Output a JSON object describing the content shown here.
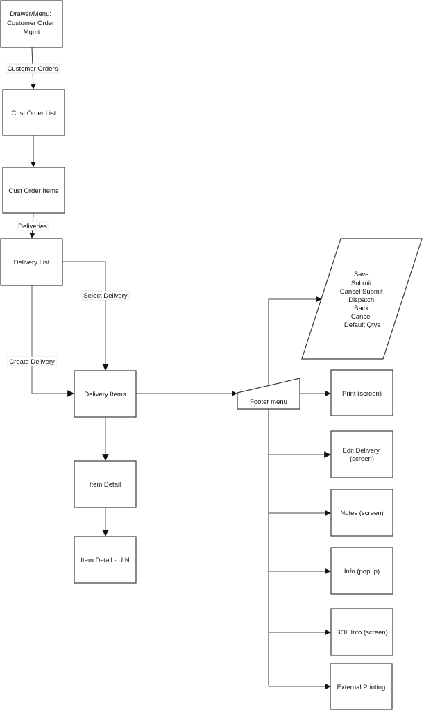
{
  "diagram": {
    "type": "flowchart",
    "nodes": {
      "drawer_menu": {
        "lines": [
          "Drawer/Menu:",
          "Customer Order",
          "Mgmt"
        ]
      },
      "cust_order_list": {
        "lines": [
          "Cust Order List"
        ]
      },
      "cust_order_items": {
        "lines": [
          "Cust Order Items"
        ]
      },
      "delivery_list": {
        "lines": [
          "Delivery List"
        ]
      },
      "delivery_items": {
        "lines": [
          "Delivery Items"
        ]
      },
      "item_detail": {
        "lines": [
          "Item Detail"
        ]
      },
      "item_detail_uin": {
        "lines": [
          "Item Detail - UIN"
        ]
      },
      "footer_menu": {
        "lines": [
          "Footer menu"
        ]
      },
      "footer_actions": {
        "lines": [
          "Save",
          "Submit",
          "Cancel Submit",
          "Dispatch",
          "Back",
          "Cancel",
          "Default Qtys"
        ]
      },
      "print_screen": {
        "lines": [
          "Print (screen)"
        ]
      },
      "edit_delivery": {
        "lines": [
          "Edit Delivery",
          "(screen)"
        ]
      },
      "notes_screen": {
        "lines": [
          "Notes (screen)"
        ]
      },
      "info_popup": {
        "lines": [
          "Info (popup)"
        ]
      },
      "bol_info": {
        "lines": [
          "BOL Info (screen)"
        ]
      },
      "external_printing": {
        "lines": [
          "External Printing"
        ]
      }
    },
    "edges": [
      {
        "from": "drawer_menu",
        "to": "cust_order_list",
        "label": "Customer Orders"
      },
      {
        "from": "cust_order_list",
        "to": "cust_order_items",
        "label": ""
      },
      {
        "from": "cust_order_items",
        "to": "delivery_list",
        "label": "Deliveries"
      },
      {
        "from": "delivery_list",
        "to": "delivery_items",
        "label": "Select Delivery"
      },
      {
        "from": "delivery_list",
        "to": "delivery_items",
        "label": "Create Delivery"
      },
      {
        "from": "delivery_items",
        "to": "footer_menu",
        "label": ""
      },
      {
        "from": "delivery_items",
        "to": "item_detail",
        "label": ""
      },
      {
        "from": "item_detail",
        "to": "item_detail_uin",
        "label": ""
      },
      {
        "from": "footer_menu",
        "to": "footer_actions",
        "label": ""
      },
      {
        "from": "footer_menu",
        "to": "print_screen",
        "label": ""
      },
      {
        "from": "footer_menu",
        "to": "edit_delivery",
        "label": ""
      },
      {
        "from": "footer_menu",
        "to": "notes_screen",
        "label": ""
      },
      {
        "from": "footer_menu",
        "to": "info_popup",
        "label": ""
      },
      {
        "from": "footer_menu",
        "to": "bol_info",
        "label": ""
      },
      {
        "from": "footer_menu",
        "to": "external_printing",
        "label": ""
      }
    ],
    "edge_labels": {
      "customer_orders": "Customer Orders",
      "deliveries": "Deliveries",
      "select_delivery": "Select Delivery",
      "create_delivery": "Create Delivery"
    }
  }
}
